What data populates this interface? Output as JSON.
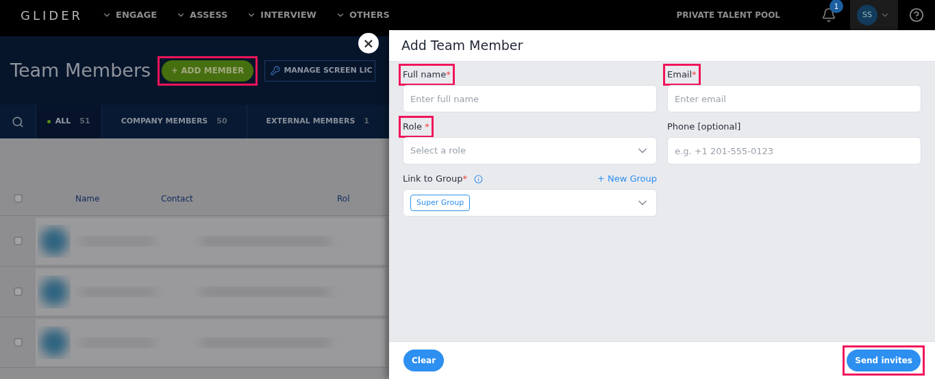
{
  "nav": {
    "brand": "GLIDER",
    "items": [
      {
        "label": "ENGAGE"
      },
      {
        "label": "ASSESS"
      },
      {
        "label": "INTERVIEW"
      },
      {
        "label": "OTHERS"
      }
    ],
    "talent_pool": "PRIVATE TALENT POOL",
    "notifications": "1",
    "avatar": "SS"
  },
  "page": {
    "title": "Team Members",
    "add_button": {
      "label": "+ ADD MEMBER",
      "highlighted": true
    },
    "manage_button": "MANAGE SCREEN LIC"
  },
  "filters": [
    {
      "label": "ALL",
      "count": "51",
      "selected": true
    },
    {
      "label": "COMPANY MEMBERS",
      "count": "50",
      "selected": false
    },
    {
      "label": "EXTERNAL MEMBERS",
      "count": "1",
      "selected": false
    }
  ],
  "table": {
    "select_all": {
      "checked": false
    },
    "columns": [
      "Name",
      "Contact",
      "Rol"
    ],
    "rows": [
      {
        "checked": false
      },
      {
        "checked": false
      },
      {
        "checked": false
      }
    ]
  },
  "dialog": {
    "title": "Add Team Member",
    "close": "×",
    "fields": [
      {
        "kind": "text",
        "label": "Full name",
        "required_mark": "*",
        "highlighted": true,
        "placeholder": "Enter full name"
      },
      {
        "kind": "text",
        "label": "Email",
        "required_mark": "*",
        "highlighted": true,
        "placeholder": "Enter email"
      },
      {
        "kind": "select",
        "label": "Role",
        "required_mark": "*",
        "highlighted": true,
        "placeholder": "Select a role"
      },
      {
        "kind": "text",
        "label": "Phone [optional]",
        "highlighted": false,
        "placeholder": "e.g. +1 201-555-0123"
      },
      {
        "kind": "tags",
        "label": "Link to Group",
        "required_mark": "*",
        "highlighted": false,
        "info": true,
        "link": "+ New Group",
        "tags": [
          "Super Group"
        ]
      }
    ],
    "clear": {
      "label": "Clear",
      "highlighted": false
    },
    "send": {
      "label": "Send invites",
      "highlighted": true
    }
  }
}
